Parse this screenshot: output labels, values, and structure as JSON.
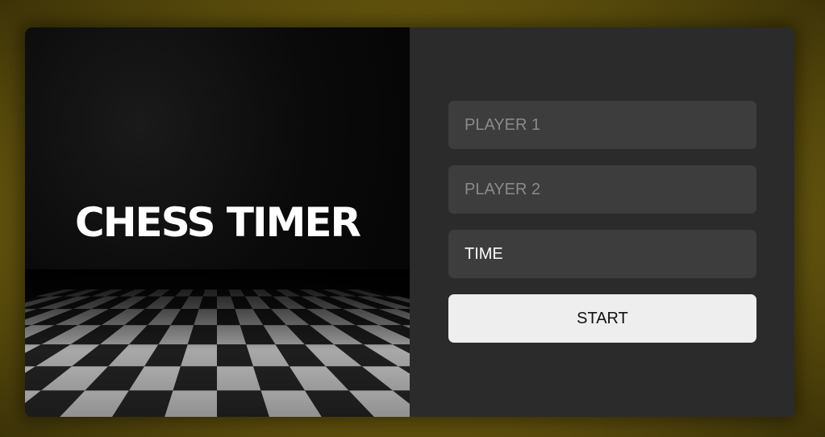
{
  "hero": {
    "title": "CHESS TIMER",
    "background": "checkered-floor-image"
  },
  "form": {
    "player1_placeholder": "PLAYER 1",
    "player1_value": "",
    "player2_placeholder": "PLAYER 2",
    "player2_value": "",
    "time_placeholder": "TIME",
    "time_value": "",
    "start_label": "START"
  },
  "colors": {
    "page_glow": "#a38a12",
    "panel_bg": "#2b2b2b",
    "field_bg": "#3d3d3d",
    "button_bg": "#eeeeee"
  }
}
